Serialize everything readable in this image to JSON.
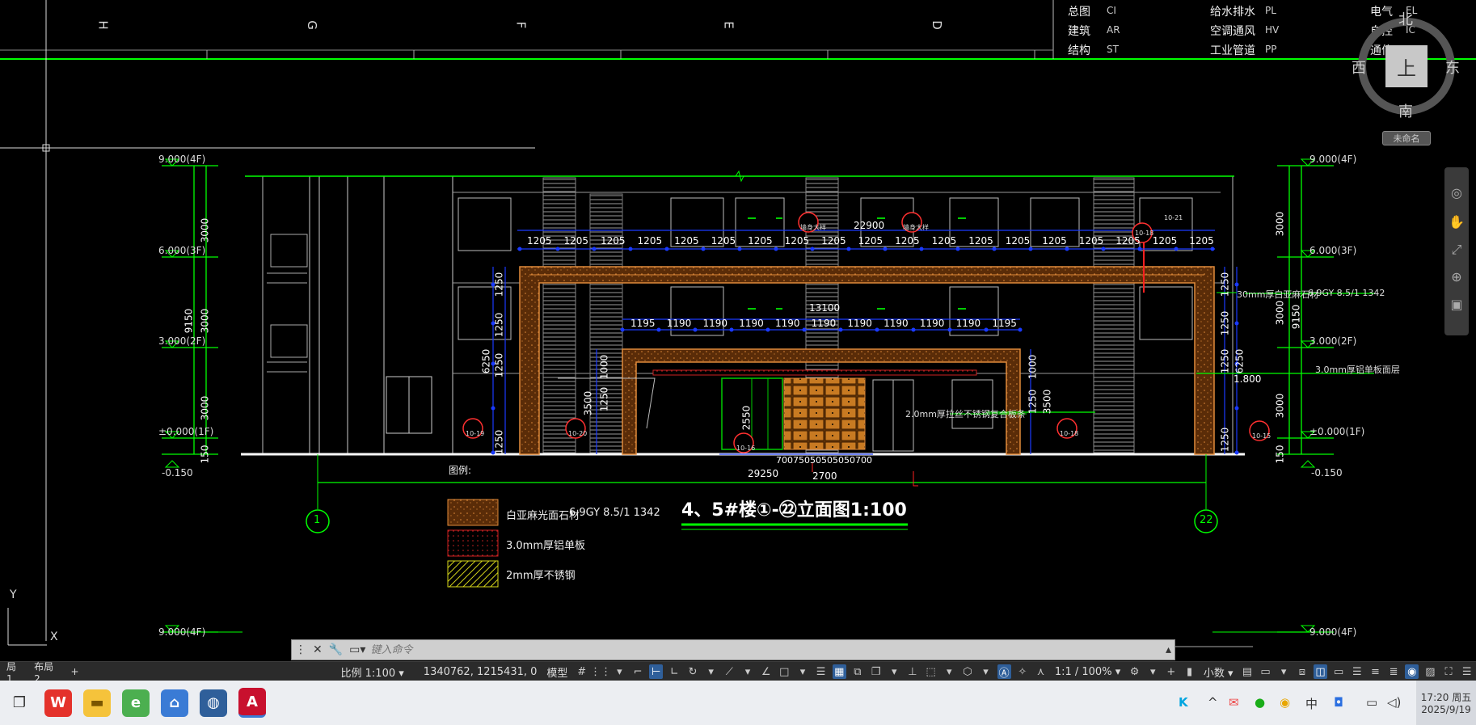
{
  "grid_letters": [
    "H",
    "G",
    "F",
    "E",
    "D"
  ],
  "title_block": {
    "rows": [
      [
        {
          "label": "总图",
          "code": "CI"
        },
        {
          "label": "给水排水",
          "code": "PL"
        },
        {
          "label": "电气",
          "code": "EL"
        }
      ],
      [
        {
          "label": "建筑",
          "code": "AR"
        },
        {
          "label": "空调通风",
          "code": "HV"
        },
        {
          "label": "自控",
          "code": "IC"
        }
      ],
      [
        {
          "label": "结构",
          "code": "ST"
        },
        {
          "label": "工业管道",
          "code": "PP"
        },
        {
          "label": "通信",
          "code": "TT"
        }
      ]
    ]
  },
  "viewcube": {
    "north": "北",
    "south": "南",
    "west": "西",
    "east": "东",
    "top": "上",
    "name": "未命名"
  },
  "levels_left": [
    "9.000(4F)",
    "6.000(3F)",
    "3.000(2F)",
    "±0.000(1F)",
    "-0.150"
  ],
  "levels_right": [
    "9.000(4F)",
    "6.000(3F)",
    "3.000(2F)",
    "±0.000(1F)",
    "-0.150"
  ],
  "levels_bottom": [
    "9.000(4F)",
    "9.000(4F)"
  ],
  "left_dims": {
    "outer": [
      "3000",
      "9150",
      "3000",
      "3000",
      "150"
    ],
    "inner": [
      "6250",
      "1250",
      "1250",
      "1250",
      "1250"
    ]
  },
  "right_dims": {
    "outer": [
      "3000",
      "3000",
      "9150",
      "3000",
      "150"
    ],
    "inner": [
      "1250",
      "1250",
      "6250",
      "1250",
      "1250"
    ]
  },
  "top_dims": {
    "total": "22900",
    "segments": [
      "1205",
      "1205",
      "1205",
      "1205",
      "1205",
      "1205",
      "1205",
      "1205",
      "1205",
      "1205",
      "1205",
      "1205",
      "1205",
      "1205",
      "1205",
      "1205",
      "1205",
      "1205",
      "1205"
    ]
  },
  "mid_dims": {
    "total": "13100",
    "segments": [
      "1195",
      "1190",
      "1190",
      "1190",
      "1190",
      "1190",
      "1190",
      "1190",
      "1190",
      "1190",
      "1195"
    ]
  },
  "bottom_dims": {
    "total": "29250",
    "center": "2700",
    "small": "70075050505050700"
  },
  "inner_vertical": [
    "1000",
    "1250",
    "3500",
    "1000",
    "3500",
    "1250",
    "2550",
    "1.800"
  ],
  "callouts_left": [
    "30mm厚白亚麻石材",
    "3.0mm厚铝单板面层"
  ],
  "callouts_right": [
    "6.9GY 8.5/1 1342"
  ],
  "mid_note": "2.0mm厚拉丝不锈钢复合板条",
  "detail_tags": [
    "墙身大样",
    "墙身大样",
    "10-18",
    "10-19",
    "10-20",
    "10-16",
    "10-18",
    "10-15",
    "10-21"
  ],
  "legend": {
    "title": "图例:",
    "items": [
      {
        "text": "白亚麻光面石材",
        "spec": "6.9GY 8.5/1 1342",
        "color": "#c46a1a"
      },
      {
        "text": "3.0mm厚铝单板",
        "spec": "",
        "color": "#cc2222"
      },
      {
        "text": "2mm厚不锈钢",
        "spec": "",
        "color": "#d8d81a"
      }
    ]
  },
  "drawing_title": "4、5#楼①-㉒立面图1:100",
  "axis_markers": [
    "1",
    "22"
  ],
  "ucs": {
    "x": "X",
    "y": "Y"
  },
  "command_line": {
    "placeholder": "键入命令"
  },
  "layout_tabs": [
    "局1",
    "布局2",
    "+"
  ],
  "status_bar": {
    "scale": "比例 1:100",
    "coords": "1340762, 1215431, 0",
    "model": "模型",
    "annot_scale": "1:1 / 100%",
    "units": "小数"
  },
  "taskbar": {
    "time": "17:20 周五",
    "date": "2025/9/19"
  },
  "colors": {
    "grid_green": "#00ff00",
    "dim_blue": "#1a3aff",
    "frame_orange": "#c46a1a",
    "red": "#ff2020",
    "white": "#ffffff"
  }
}
